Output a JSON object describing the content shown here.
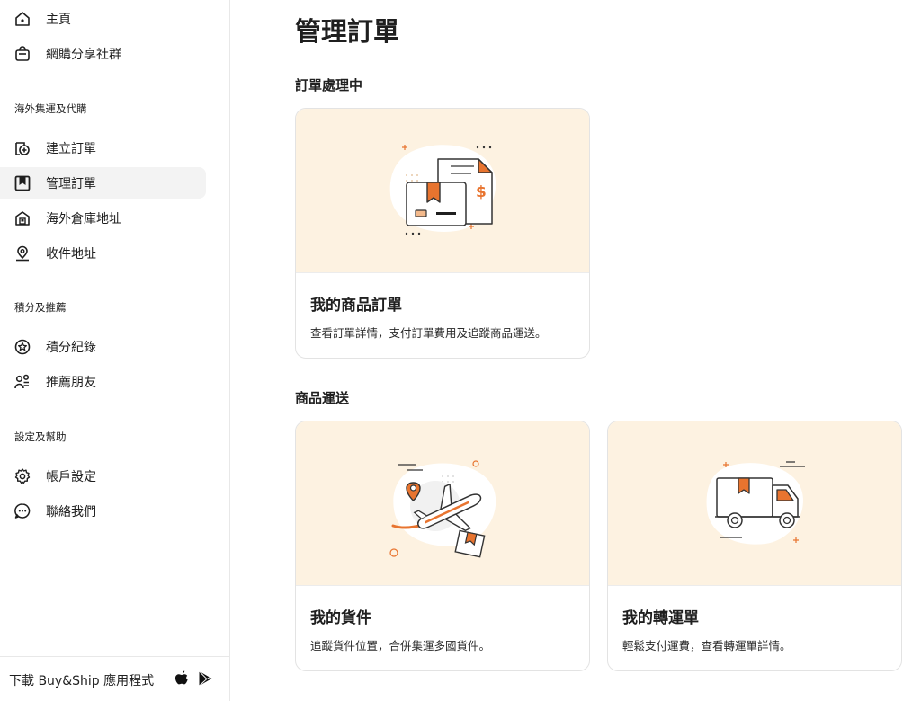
{
  "sidebar": {
    "top_items": [
      {
        "label": "主頁",
        "icon": "home-icon"
      },
      {
        "label": "網購分享社群",
        "icon": "shopping-bag-icon"
      }
    ],
    "sections": [
      {
        "title": "海外集運及代購",
        "items": [
          {
            "label": "建立訂單",
            "icon": "add-order-icon"
          },
          {
            "label": "管理訂單",
            "icon": "bookmark-icon",
            "active": true
          },
          {
            "label": "海外倉庫地址",
            "icon": "warehouse-icon"
          },
          {
            "label": "收件地址",
            "icon": "location-pin-icon"
          }
        ]
      },
      {
        "title": "積分及推薦",
        "items": [
          {
            "label": "積分紀錄",
            "icon": "star-badge-icon"
          },
          {
            "label": "推薦朋友",
            "icon": "people-icon"
          }
        ]
      },
      {
        "title": "設定及幫助",
        "items": [
          {
            "label": "帳戶設定",
            "icon": "gear-icon"
          },
          {
            "label": "聯絡我們",
            "icon": "chat-icon"
          }
        ]
      }
    ],
    "download_label": "下載 Buy&Ship 應用程式"
  },
  "main": {
    "title": "管理訂單",
    "sections": [
      {
        "title": "訂單處理中",
        "cards": [
          {
            "title": "我的商品訂單",
            "desc": "查看訂單詳情，支付訂單費用及追蹤商品運送。"
          }
        ]
      },
      {
        "title": "商品運送",
        "cards": [
          {
            "title": "我的貨件",
            "desc": "追蹤貨件位置，合併集運多國貨件。"
          },
          {
            "title": "我的轉運單",
            "desc": "輕鬆支付運費，查看轉運單詳情。"
          }
        ]
      }
    ]
  },
  "colors": {
    "accent": "#e8742f",
    "illustration_bg": "#fdf2e1",
    "active_nav_bg": "#f3f3f3"
  }
}
